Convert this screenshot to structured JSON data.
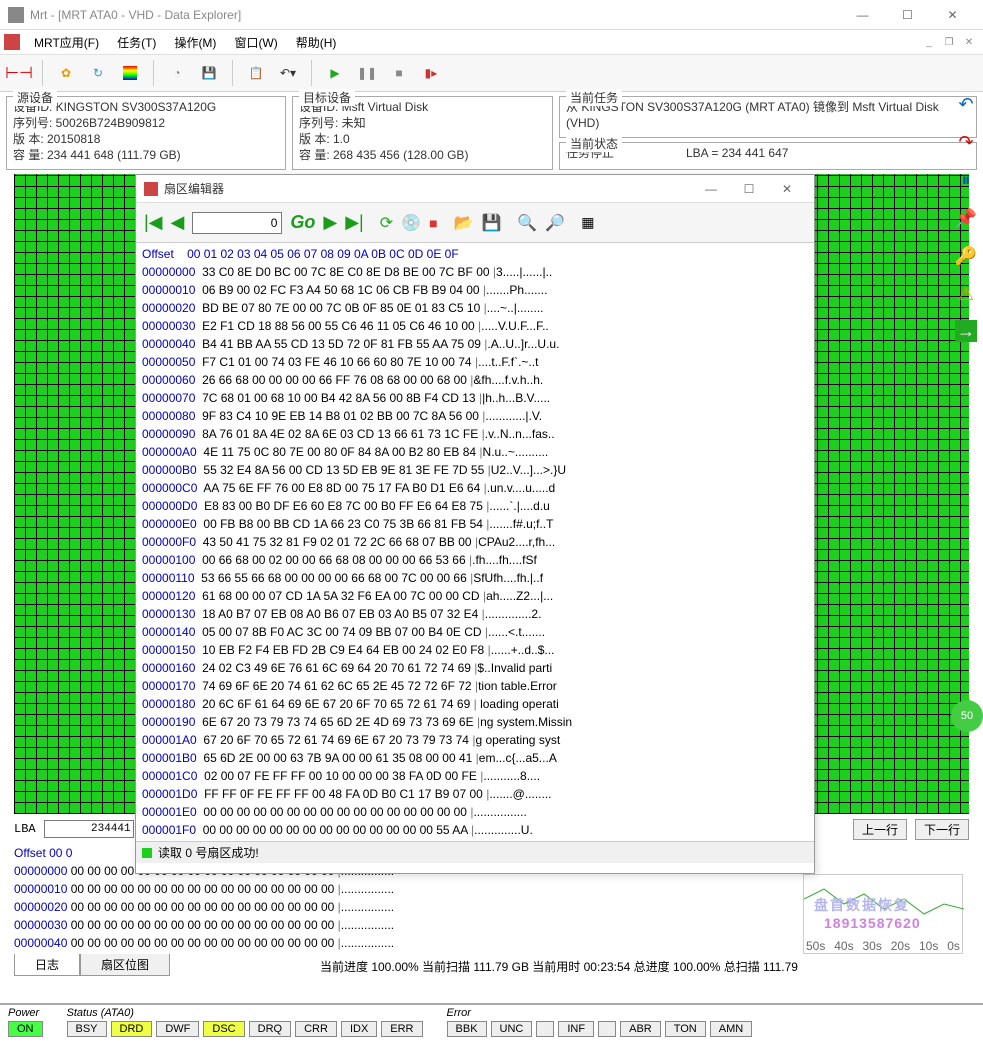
{
  "window": {
    "title": "Mrt - [MRT ATA0 - VHD - Data Explorer]"
  },
  "menus": [
    "MRT应用(F)",
    "任务(T)",
    "操作(M)",
    "窗口(W)",
    "帮助(H)"
  ],
  "info": {
    "src": {
      "legend": "源设备",
      "l1": "设备ID: KINGSTON SV300S37A120G",
      "l2": "序列号: 50026B724B909812",
      "l3": "版  本: 20150818",
      "l4": "容  量: 234 441 648 (111.79 GB)"
    },
    "dst": {
      "legend": "目标设备",
      "l1": "设备ID: Msft Virtual Disk",
      "l2": "序列号: 未知",
      "l3": "版  本: 1.0",
      "l4": "容  量: 268 435 456 (128.00 GB)"
    },
    "task": {
      "legend": "当前任务",
      "l1": "从 KINGSTON SV300S37A120G (MRT ATA0) 镜像到 Msft Virtual Disk (VHD)"
    },
    "state": {
      "legend": "当前状态",
      "l1": "任务停止",
      "l2": "LBA = 234 441 647"
    }
  },
  "sector_editor": {
    "title": "扇区编辑器",
    "go": "Go",
    "input": "0",
    "status": "读取 0 号扇区成功!",
    "header": "Offset    00 01 02 03 04 05 06 07 08 09 0A 0B 0C 0D 0E 0F",
    "rows": [
      {
        "o": "00000000",
        "h": "33 C0 8E D0 BC 00 7C 8E C0 8E D8 BE 00 7C BF 00",
        "a": "3.....|......|.."
      },
      {
        "o": "00000010",
        "h": "06 B9 00 02 FC F3 A4 50 68 1C 06 CB FB B9 04 00",
        "a": ".......Ph......."
      },
      {
        "o": "00000020",
        "h": "BD BE 07 80 7E 00 00 7C 0B 0F 85 0E 01 83 C5 10",
        "a": "....~..|........"
      },
      {
        "o": "00000030",
        "h": "E2 F1 CD 18 88 56 00 55 C6 46 11 05 C6 46 10 00",
        "a": ".....V.U.F...F.."
      },
      {
        "o": "00000040",
        "h": "B4 41 BB AA 55 CD 13 5D 72 0F 81 FB 55 AA 75 09",
        "a": ".A..U..]r...U.u."
      },
      {
        "o": "00000050",
        "h": "F7 C1 01 00 74 03 FE 46 10 66 60 80 7E 10 00 74",
        "a": "....t..F.f`.~..t"
      },
      {
        "o": "00000060",
        "h": "26 66 68 00 00 00 00 66 FF 76 08 68 00 00 68 00",
        "a": "&fh....f.v.h..h."
      },
      {
        "o": "00000070",
        "h": "7C 68 01 00 68 10 00 B4 42 8A 56 00 8B F4 CD 13",
        "a": "|h..h...B.V....."
      },
      {
        "o": "00000080",
        "h": "9F 83 C4 10 9E EB 14 B8 01 02 BB 00 7C 8A 56 00",
        "a": "............|.V."
      },
      {
        "o": "00000090",
        "h": "8A 76 01 8A 4E 02 8A 6E 03 CD 13 66 61 73 1C FE",
        "a": ".v..N..n...fas.."
      },
      {
        "o": "000000A0",
        "h": "4E 11 75 0C 80 7E 00 80 0F 84 8A 00 B2 80 EB 84",
        "a": "N.u..~.........."
      },
      {
        "o": "000000B0",
        "h": "55 32 E4 8A 56 00 CD 13 5D EB 9E 81 3E FE 7D 55",
        "a": "U2..V...]...>.}U"
      },
      {
        "o": "000000C0",
        "h": "AA 75 6E FF 76 00 E8 8D 00 75 17 FA B0 D1 E6 64",
        "a": ".un.v....u.....d"
      },
      {
        "o": "000000D0",
        "h": "E8 83 00 B0 DF E6 60 E8 7C 00 B0 FF E6 64 E8 75",
        "a": "......`.|....d.u"
      },
      {
        "o": "000000E0",
        "h": "00 FB B8 00 BB CD 1A 66 23 C0 75 3B 66 81 FB 54",
        "a": ".......f#.u;f..T"
      },
      {
        "o": "000000F0",
        "h": "43 50 41 75 32 81 F9 02 01 72 2C 66 68 07 BB 00",
        "a": "CPAu2....r,fh..."
      },
      {
        "o": "00000100",
        "h": "00 66 68 00 02 00 00 66 68 08 00 00 00 66 53 66",
        "a": ".fh....fh....fSf"
      },
      {
        "o": "00000110",
        "h": "53 66 55 66 68 00 00 00 00 66 68 00 7C 00 00 66",
        "a": "SfUfh....fh.|..f"
      },
      {
        "o": "00000120",
        "h": "61 68 00 00 07 CD 1A 5A 32 F6 EA 00 7C 00 00 CD",
        "a": "ah.....Z2...|..."
      },
      {
        "o": "00000130",
        "h": "18 A0 B7 07 EB 08 A0 B6 07 EB 03 A0 B5 07 32 E4",
        "a": "..............2."
      },
      {
        "o": "00000140",
        "h": "05 00 07 8B F0 AC 3C 00 74 09 BB 07 00 B4 0E CD",
        "a": "......<.t......."
      },
      {
        "o": "00000150",
        "h": "10 EB F2 F4 EB FD 2B C9 E4 64 EB 00 24 02 E0 F8",
        "a": "......+..d..$..."
      },
      {
        "o": "00000160",
        "h": "24 02 C3 49 6E 76 61 6C 69 64 20 70 61 72 74 69",
        "a": "$..Invalid parti"
      },
      {
        "o": "00000170",
        "h": "74 69 6F 6E 20 74 61 62 6C 65 2E 45 72 72 6F 72",
        "a": "tion table.Error"
      },
      {
        "o": "00000180",
        "h": "20 6C 6F 61 64 69 6E 67 20 6F 70 65 72 61 74 69",
        "a": " loading operati"
      },
      {
        "o": "00000190",
        "h": "6E 67 20 73 79 73 74 65 6D 2E 4D 69 73 73 69 6E",
        "a": "ng system.Missin"
      },
      {
        "o": "000001A0",
        "h": "67 20 6F 70 65 72 61 74 69 6E 67 20 73 79 73 74",
        "a": "g operating syst"
      },
      {
        "o": "000001B0",
        "h": "65 6D 2E 00 00 63 7B 9A 00 00 61 35 08 00 00 41",
        "a": "em...c{...a5...A"
      },
      {
        "o": "000001C0",
        "h": "02 00 07 FE FF FF 00 10 00 00 00 38 FA 0D 00 FE",
        "a": "...........8...."
      },
      {
        "o": "000001D0",
        "h": "FF FF 0F FE FF FF 00 48 FA 0D B0 C1 17 B9 07 00",
        "a": ".......@........"
      },
      {
        "o": "000001E0",
        "h": "00 00 00 00 00 00 00 00 00 00 00 00 00 00 00 00",
        "a": "................"
      },
      {
        "o": "000001F0",
        "h": "00 00 00 00 00 00 00 00 00 00 00 00 00 00 55 AA",
        "a": "..............U."
      }
    ]
  },
  "lba": {
    "label": "LBA",
    "value": "234441",
    "btn_prev": "上一行",
    "btn_next": "下一行"
  },
  "bottom_hex": {
    "header": "Offset    00 0",
    "rows": [
      {
        "o": "00000000",
        "h": "00 00 00 00 00 00 00 00 00 00 00 00 00 00 00 00",
        "a": "................"
      },
      {
        "o": "00000010",
        "h": "00 00 00 00 00 00 00 00 00 00 00 00 00 00 00 00",
        "a": "................"
      },
      {
        "o": "00000020",
        "h": "00 00 00 00 00 00 00 00 00 00 00 00 00 00 00 00",
        "a": "................"
      },
      {
        "o": "00000030",
        "h": "00 00 00 00 00 00 00 00 00 00 00 00 00 00 00 00",
        "a": "................"
      },
      {
        "o": "00000040",
        "h": "00 00 00 00 00 00 00 00 00 00 00 00 00 00 00 00",
        "a": "................"
      }
    ]
  },
  "tabs": {
    "t1": "日志",
    "t2": "扇区位图"
  },
  "progress": "当前进度 100.00% 当前扫描 111.79 GB 当前用时 00:23:54  总进度 100.00% 总扫描 111.79",
  "status": {
    "power": {
      "lbl": "Power",
      "v": "ON"
    },
    "ata": {
      "lbl": "Status (ATA0)",
      "chips": [
        "BSY",
        "DRD",
        "DWF",
        "DSC",
        "DRQ",
        "CRR",
        "IDX",
        "ERR"
      ]
    },
    "err": {
      "lbl": "Error",
      "chips": [
        "BBK",
        "UNC",
        "",
        "INF",
        "",
        "ABR",
        "TON",
        "AMN"
      ]
    }
  },
  "graph": {
    "wm1": "盘首数据恢复",
    "wm2": "18913587620",
    "ticks": [
      "50s",
      "40s",
      "30s",
      "20s",
      "10s",
      "0s"
    ]
  },
  "badge": "50"
}
